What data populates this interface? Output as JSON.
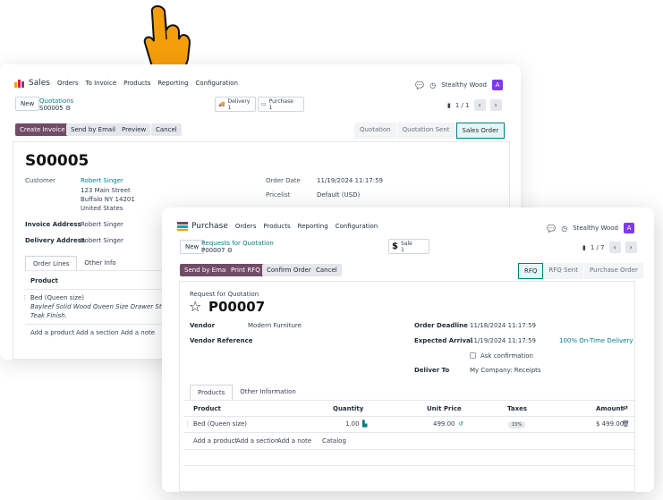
{
  "sales": {
    "app_name": "Sales",
    "menu": [
      "Orders",
      "To Invoice",
      "Products",
      "Reporting",
      "Configuration"
    ],
    "company": "Stealthy Wood",
    "avatar": "A",
    "new_label": "New",
    "breadcrumb_parent": "Quotations",
    "record_name": "S00005",
    "smart_buttons": [
      {
        "label": "Delivery",
        "count": "1"
      },
      {
        "label": "Purchase",
        "count": "1"
      }
    ],
    "pager": "1 / 1",
    "actions": [
      "Create Invoice",
      "Send by Email",
      "Preview",
      "Cancel"
    ],
    "statusbar": [
      "Quotation",
      "Quotation Sent",
      "Sales Order"
    ],
    "title": "S00005",
    "customer_label": "Customer",
    "customer_name": "Robert Singer",
    "customer_address": [
      "123 Main Street",
      "Buffalo NY 14201",
      "United States"
    ],
    "invoice_address_label": "Invoice Address",
    "invoice_address": "Robert Singer",
    "delivery_address_label": "Delivery Address",
    "delivery_address": "Robert Singer",
    "order_date_label": "Order Date",
    "order_date": "11/19/2024 11:17:59",
    "pricelist_label": "Pricelist",
    "pricelist": "Default (USD)",
    "tabs": [
      "Order Lines",
      "Other Info"
    ],
    "col_product": "Product",
    "line_product": "Bed (Queen size)",
    "line_desc_1": "Bayleef Solid Wood Queen Size Drawer Storage B",
    "line_desc_2": "Teak Finish.",
    "add_links": [
      "Add a product",
      "Add a section",
      "Add a note"
    ]
  },
  "purchase": {
    "app_name": "Purchase",
    "menu": [
      "Orders",
      "Products",
      "Reporting",
      "Configuration"
    ],
    "company": "Stealthy Wood",
    "avatar": "A",
    "new_label": "New",
    "breadcrumb_parent": "Requests for Quotation",
    "record_name": "P00007",
    "smart_button": {
      "label": "Sale",
      "count": "1"
    },
    "pager": "1 / 7",
    "actions": [
      "Send by Email",
      "Print RFQ",
      "Confirm Order",
      "Cancel"
    ],
    "statusbar": [
      "RFQ",
      "RFQ Sent",
      "Purchase Order"
    ],
    "doc_type": "Request for Quotation",
    "title": "P00007",
    "vendor_label": "Vendor",
    "vendor": "Modern Furniture",
    "vendor_ref_label": "Vendor Reference",
    "deadline_label": "Order Deadline",
    "deadline": "11/18/2024 11:17:59",
    "arrival_label": "Expected Arrival",
    "arrival": "11/19/2024 11:17:59",
    "ontime": "100% On-Time Delivery",
    "ask_confirmation": "Ask confirmation",
    "deliver_to_label": "Deliver To",
    "deliver_to": "My Company: Receipts",
    "tabs": [
      "Products",
      "Other Information"
    ],
    "columns": [
      "Product",
      "Quantity",
      "Unit Price",
      "Taxes",
      "Amount"
    ],
    "line": {
      "product": "Bed (Queen size)",
      "qty": "1.00",
      "price": "499.00",
      "tax": "15%",
      "amount": "$ 499.00"
    },
    "add_links": [
      "Add a product",
      "Add a section",
      "Add a note",
      "Catalog"
    ]
  },
  "colors": {
    "accent": "#714b67",
    "link": "#017e84",
    "avatar": "#7c3aed",
    "hand": "#f59e0b"
  }
}
